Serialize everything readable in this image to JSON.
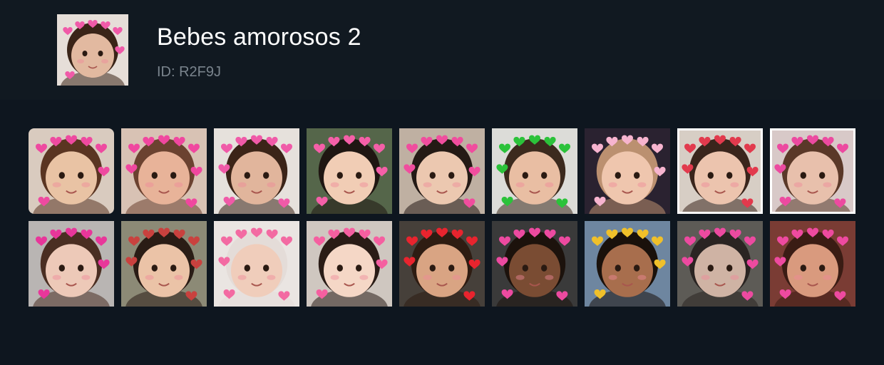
{
  "pack": {
    "title": "Bebes amorosos 2",
    "id_label": "ID: R2F9J",
    "thumbnail": {
      "bg": "#e6ded8",
      "skin": "#e2b9a0",
      "hair": "#3a2418",
      "hearts": "#f05aa8",
      "frame": "none"
    }
  },
  "stickers": [
    {
      "bg": "#d9cbbf",
      "skin": "#e9c3a4",
      "hair": "#5a3522",
      "hearts": "#ee4aa0",
      "frame": "round"
    },
    {
      "bg": "#d8c2b4",
      "skin": "#e8b399",
      "hair": "#6b4230",
      "hearts": "#f0479f",
      "frame": "none"
    },
    {
      "bg": "#e6e1dc",
      "skin": "#e1b59c",
      "hair": "#3b2418",
      "hearts": "#f05aa8",
      "frame": "none"
    },
    {
      "bg": "#55664a",
      "skin": "#f1cdb5",
      "hair": "#1f1612",
      "hearts": "#f55fa8",
      "frame": "none"
    },
    {
      "bg": "#bfb0a2",
      "skin": "#ecc8b0",
      "hair": "#241a15",
      "hearts": "#f04d9e",
      "frame": "none"
    },
    {
      "bg": "#dcdcd8",
      "skin": "#e9bea3",
      "hair": "#3c2a1e",
      "hearts": "#2bc23a",
      "frame": "none"
    },
    {
      "bg": "#2a2230",
      "skin": "#efc6ae",
      "hair": "#bb9070",
      "hearts": "#f7b4cf",
      "frame": "none"
    },
    {
      "bg": "#d7cec5",
      "skin": "#ecc4ae",
      "hair": "#3a251c",
      "hearts": "#e23a4d",
      "frame": "white"
    },
    {
      "bg": "#d8c9c8",
      "skin": "#e8c0ac",
      "hair": "#5a3828",
      "hearts": "#ec4aa0",
      "frame": "white"
    },
    {
      "bg": "#b9b5b3",
      "skin": "#edc9b8",
      "hair": "#4a2e22",
      "hearts": "#e8369a",
      "frame": "none"
    },
    {
      "bg": "#8c8a76",
      "skin": "#ebc3a7",
      "hair": "#2a1c15",
      "hearts": "#c9413e",
      "frame": "none"
    },
    {
      "bg": "#eae5e2",
      "skin": "#f0cdbb",
      "hair": "#e4dcd8",
      "hearts": "#f36aa2",
      "frame": "none"
    },
    {
      "bg": "#cfc7c0",
      "skin": "#f5d7c6",
      "hair": "#2a1c16",
      "hearts": "#f55fa0",
      "frame": "none"
    },
    {
      "bg": "#46403a",
      "skin": "#d9a483",
      "hair": "#2e1c12",
      "hearts": "#e8242e",
      "frame": "none"
    },
    {
      "bg": "#3a3a3a",
      "skin": "#7a4c33",
      "hair": "#1c120c",
      "hearts": "#ec4aa0",
      "frame": "none"
    },
    {
      "bg": "#6e86a0",
      "skin": "#a86e4d",
      "hair": "#1a110b",
      "hearts": "#f0c02a",
      "frame": "none"
    },
    {
      "bg": "#5d5b56",
      "skin": "#cfb3a4",
      "hair": "#2a2422",
      "hearts": "#ec4aa0",
      "frame": "none"
    },
    {
      "bg": "#7a3c34",
      "skin": "#d99a7e",
      "hair": "#3a1c14",
      "hearts": "#ee4aa0",
      "frame": "none"
    }
  ]
}
